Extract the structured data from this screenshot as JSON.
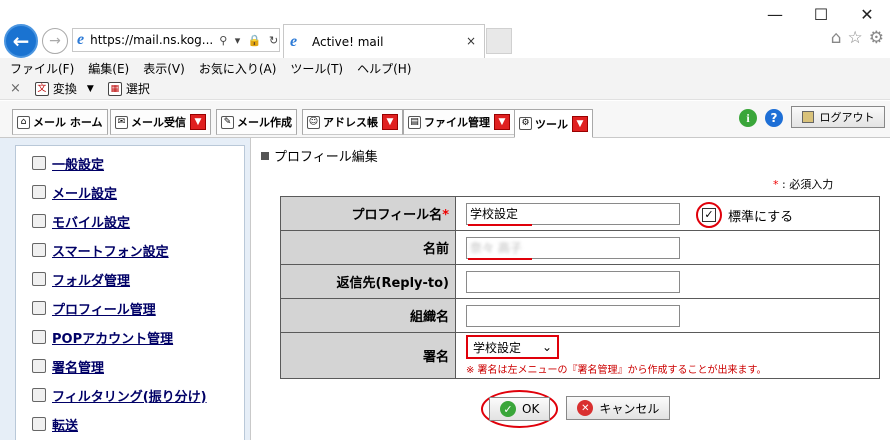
{
  "browser": {
    "url": "https://mail.ns.kog...",
    "url_icons": "⚲ ▾ 🔒 ↻",
    "tab_title": "Active! mail",
    "tab_close": "×",
    "window_controls": [
      "—",
      "☐",
      "✕"
    ],
    "menu": [
      "ファイル(F)",
      "編集(E)",
      "表示(V)",
      "お気に入り(A)",
      "ツール(T)",
      "ヘルプ(H)"
    ],
    "command_bar": {
      "close": "×",
      "convert": "変換",
      "select": "選択"
    }
  },
  "app_tabs": [
    {
      "label": "メール ホーム",
      "icon": "home-icon",
      "dropdown": false
    },
    {
      "label": "メール受信",
      "icon": "inbox-icon",
      "dropdown": true
    },
    {
      "label": "メール作成",
      "icon": "compose-icon",
      "dropdown": false
    },
    {
      "label": "アドレス帳",
      "icon": "addressbook-icon",
      "dropdown": true
    },
    {
      "label": "ファイル管理",
      "icon": "folder-icon",
      "dropdown": true
    },
    {
      "label": "ツール",
      "icon": "gear-icon",
      "dropdown": true,
      "active": true
    }
  ],
  "toolbar_right": {
    "help_green": "i",
    "help_blue": "?",
    "logout_label": "ログアウト"
  },
  "sidebar": {
    "items": [
      "一般設定",
      "メール設定",
      "モバイル設定",
      "スマートフォン設定",
      "フォルダ管理",
      "プロフィール管理",
      "POPアカウント管理",
      "署名管理",
      "フィルタリング(振り分け)",
      "転送"
    ]
  },
  "main": {
    "section_title": "プロフィール編集",
    "required_star": "*",
    "required_note": ": 必須入力",
    "fields": {
      "profile_name_label": "プロフィール名",
      "profile_name_value": "学校設定",
      "default_label": "標準にする",
      "default_checked": "✓",
      "name_label": "名前",
      "name_value": "奈々 高子",
      "reply_to_label": "返信先(Reply-to)",
      "reply_to_value": "",
      "org_label": "組織名",
      "org_value": "",
      "signature_label": "署名",
      "signature_value": "学校設定",
      "signature_note": "※ 署名は左メニューの『署名管理』から作成することが出来ます。"
    },
    "ok_label": "OK",
    "cancel_label": "キャンセル"
  },
  "colors": {
    "annotation_red": "#e0000a",
    "link_navy": "#000066",
    "label_bg": "#d4d4d4"
  }
}
